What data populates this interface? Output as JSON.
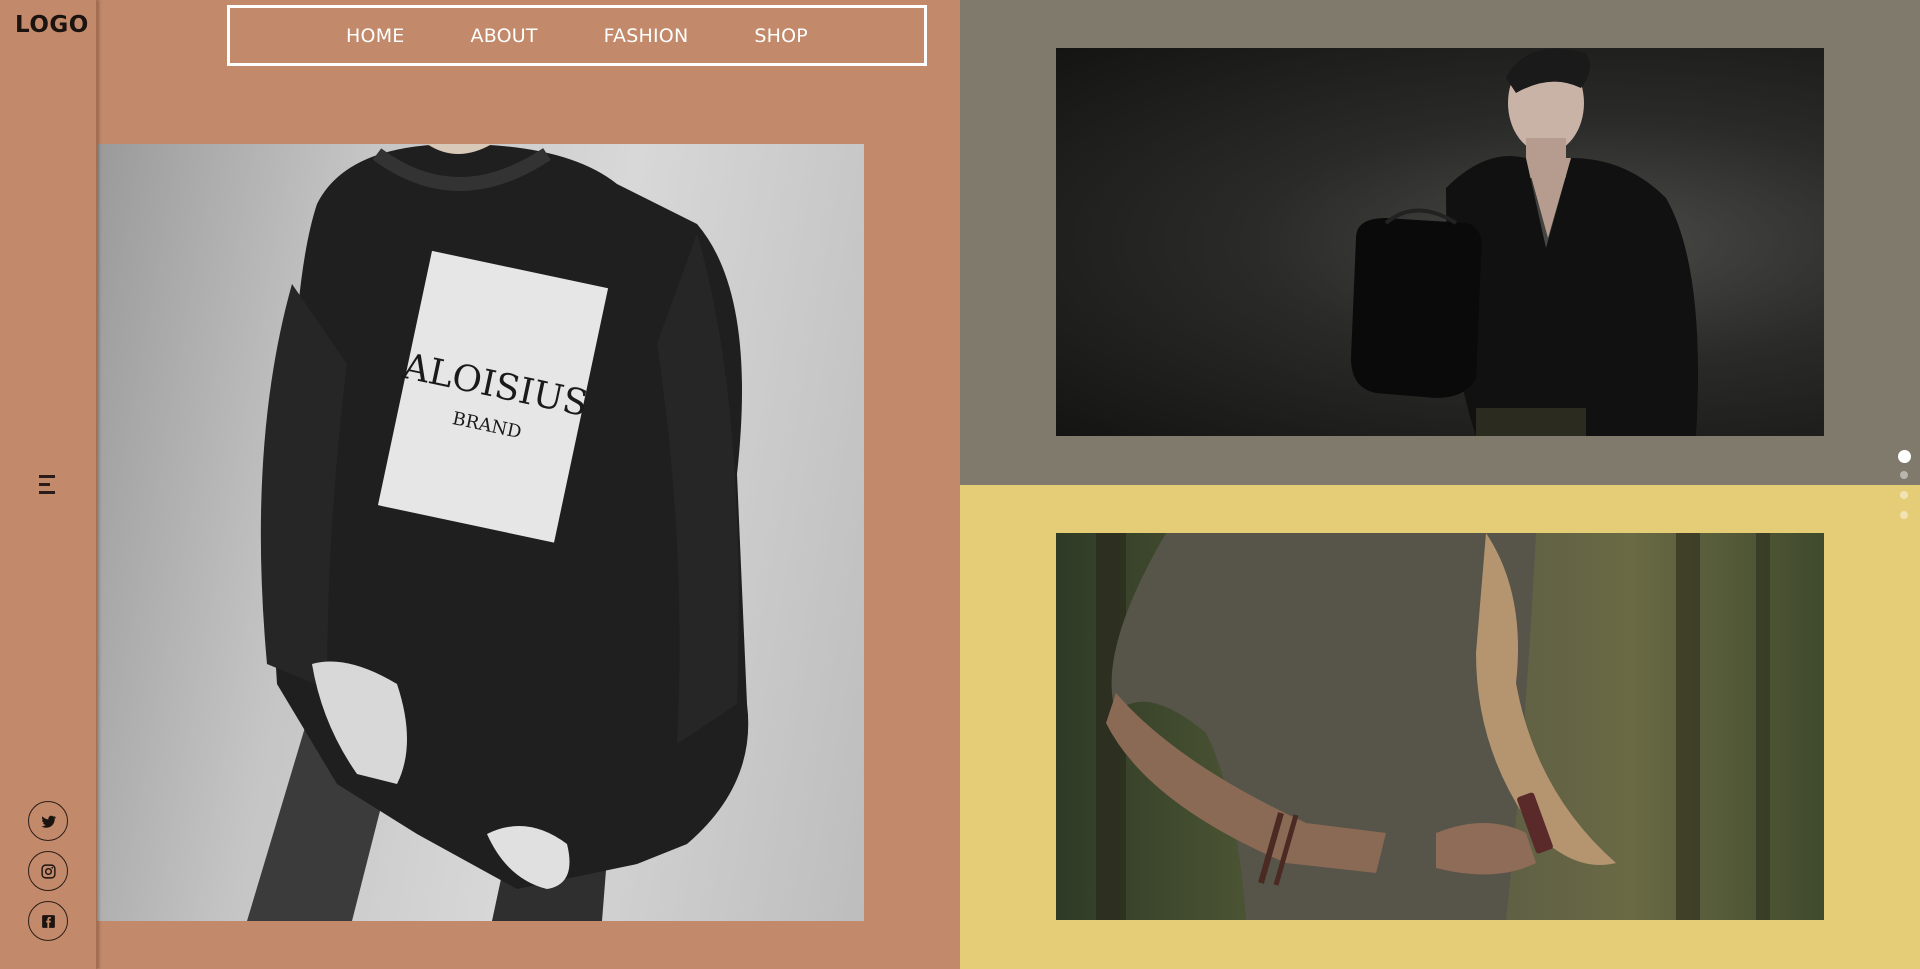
{
  "sidebar": {
    "logo": "LOGO",
    "menu_icon": "hamburger-menu-icon",
    "social": [
      {
        "name": "twitter",
        "icon": "twitter-icon"
      },
      {
        "name": "instagram",
        "icon": "instagram-icon"
      },
      {
        "name": "facebook",
        "icon": "facebook-icon"
      }
    ]
  },
  "nav": {
    "items": [
      "HOME",
      "ABOUT",
      "FASHION",
      "SHOP"
    ]
  },
  "hero": {
    "shirt_brand": "ALOISIUS",
    "shirt_sub": "BRAND"
  },
  "slider": {
    "dot_count": 4,
    "active_index": 0
  },
  "colors": {
    "left_bg": "#c2896a",
    "right_top_bg": "#7f7a6c",
    "right_bottom_bg": "#e5cc77"
  }
}
